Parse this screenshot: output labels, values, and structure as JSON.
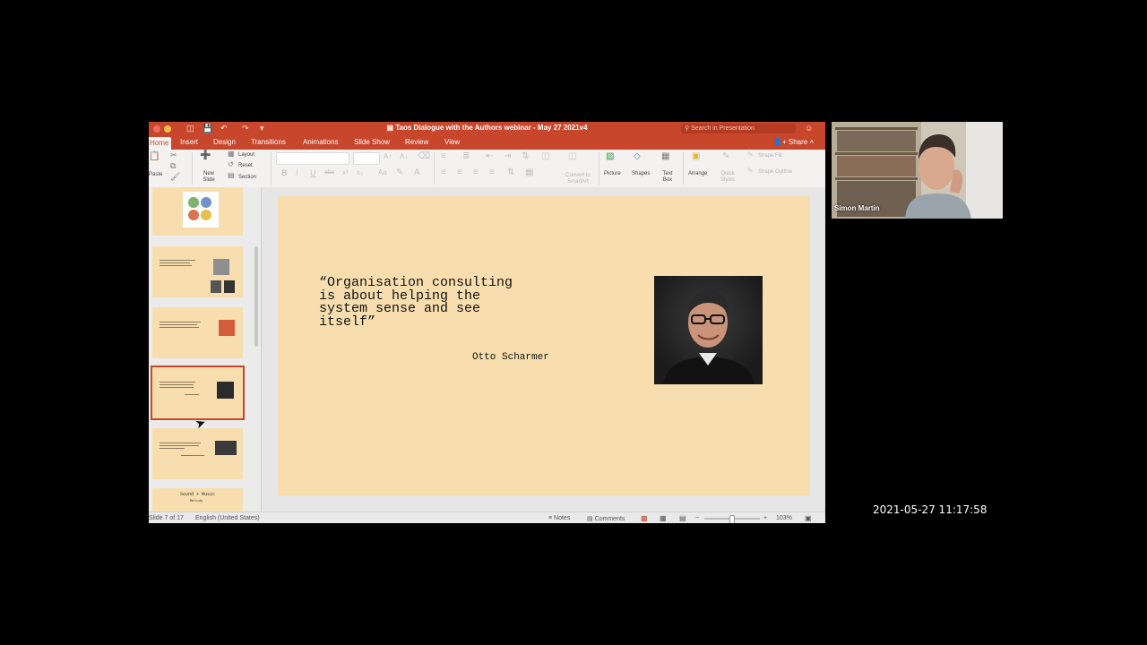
{
  "window": {
    "title": "Taos Dialogue with the Authors webinar - May 27 2021v4",
    "search_placeholder": "Search in Presentation"
  },
  "tabs": [
    {
      "label": "Home",
      "active": true
    },
    {
      "label": "Insert"
    },
    {
      "label": "Design"
    },
    {
      "label": "Transitions"
    },
    {
      "label": "Animations"
    },
    {
      "label": "Slide Show"
    },
    {
      "label": "Review"
    },
    {
      "label": "View"
    }
  ],
  "share_label": "Share",
  "ribbon": {
    "paste": "Paste",
    "new_slide": "New Slide",
    "layout": "Layout",
    "reset": "Reset",
    "section": "Section",
    "convert_smartart": "Convert to SmartArt",
    "picture": "Picture",
    "shapes": "Shapes",
    "text_box": "Text Box",
    "arrange": "Arrange",
    "quick_styles": "Quick Styles",
    "shape_fill": "Shape Fill",
    "shape_outline": "Shape Outline"
  },
  "thumbnails": {
    "slide_9_text": "Sound + Music",
    "slide_9_sub": "Melody"
  },
  "slide": {
    "quote": "“Organisation consulting\nis about helping the\nsystem sense and see\nitself”",
    "author": "Otto Scharmer"
  },
  "status": {
    "slide_count": "Slide 7 of 17",
    "language": "English (United States)",
    "notes": "Notes",
    "comments": "Comments",
    "zoom": "103%"
  },
  "video": {
    "name": "Simon Martin"
  },
  "timestamp": "2021-05-27  11:17:58",
  "colors": {
    "accent": "#c8462c",
    "slide_bg": "#f8deae"
  }
}
